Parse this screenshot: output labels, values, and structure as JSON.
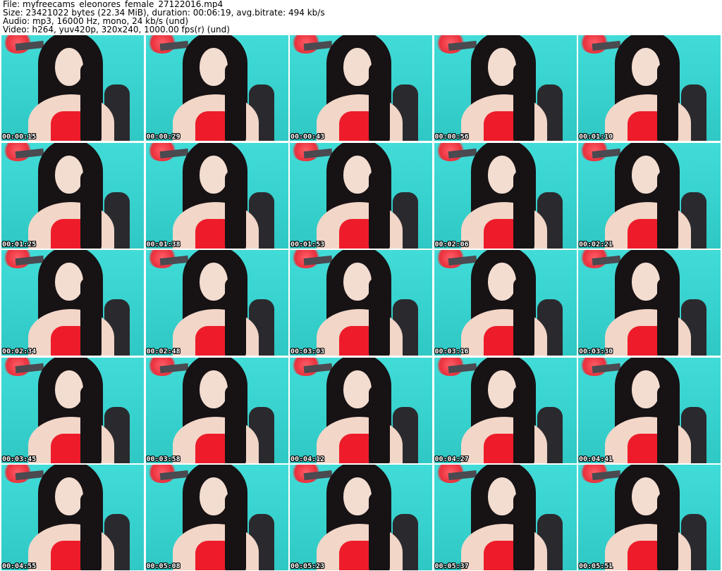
{
  "header": {
    "file": "File: myfreecams_eleonores_female_27122016.mp4",
    "size": "Size: 23421022 bytes (22.34 MiB), duration: 00:06:19, avg.bitrate: 494 kb/s",
    "audio": "Audio: mp3, 16000 Hz, mono, 24 kb/s (und)",
    "video": "Video: h264, yuv420p, 320x240, 1000.00 fps(r) (und)"
  },
  "thumbnails": [
    {
      "timestamp": "00:00:15"
    },
    {
      "timestamp": "00:00:29"
    },
    {
      "timestamp": "00:00:43"
    },
    {
      "timestamp": "00:00:56"
    },
    {
      "timestamp": "00:01:10"
    },
    {
      "timestamp": "00:01:25"
    },
    {
      "timestamp": "00:01:38"
    },
    {
      "timestamp": "00:01:53"
    },
    {
      "timestamp": "00:02:06"
    },
    {
      "timestamp": "00:02:21"
    },
    {
      "timestamp": "00:02:34"
    },
    {
      "timestamp": "00:02:48"
    },
    {
      "timestamp": "00:03:03"
    },
    {
      "timestamp": "00:03:16"
    },
    {
      "timestamp": "00:03:30"
    },
    {
      "timestamp": "00:03:45"
    },
    {
      "timestamp": "00:03:58"
    },
    {
      "timestamp": "00:04:12"
    },
    {
      "timestamp": "00:04:27"
    },
    {
      "timestamp": "00:04:41"
    },
    {
      "timestamp": "00:04:55"
    },
    {
      "timestamp": "00:05:08"
    },
    {
      "timestamp": "00:05:23"
    },
    {
      "timestamp": "00:05:37"
    },
    {
      "timestamp": "00:05:51"
    }
  ],
  "colors": {
    "background": "#3ed7d4",
    "top": "#ee1c2a",
    "hair": "#171214"
  }
}
